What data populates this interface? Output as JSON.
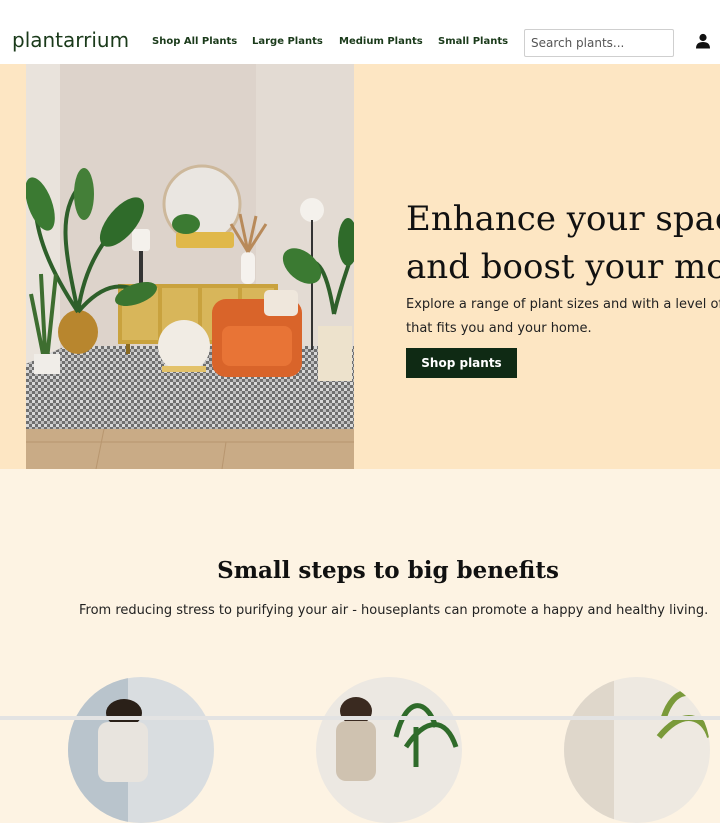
{
  "brand": {
    "logo_text": "plantarrium"
  },
  "nav": {
    "links": [
      {
        "label": "Shop All Plants"
      },
      {
        "label": "Large Plants"
      },
      {
        "label": "Medium Plants"
      },
      {
        "label": "Small Plants"
      }
    ],
    "search_placeholder": "Search plants...",
    "user_icon": "user-icon"
  },
  "hero": {
    "title_line1": "Enhance your space",
    "title_line2": "and boost your mood",
    "desc_line1": "Explore a range of plant sizes and with a level of care",
    "desc_line2": "that fits you and your home.",
    "cta_label": "Shop plants",
    "background_color": "#fde6c3",
    "cta_color": "#0f2a14"
  },
  "benefits": {
    "title": "Small steps to big benefits",
    "subtitle": "From reducing stress to purifying your air - houseplants can promote a happy and healthy living.",
    "background_color": "#fdf3e3"
  }
}
